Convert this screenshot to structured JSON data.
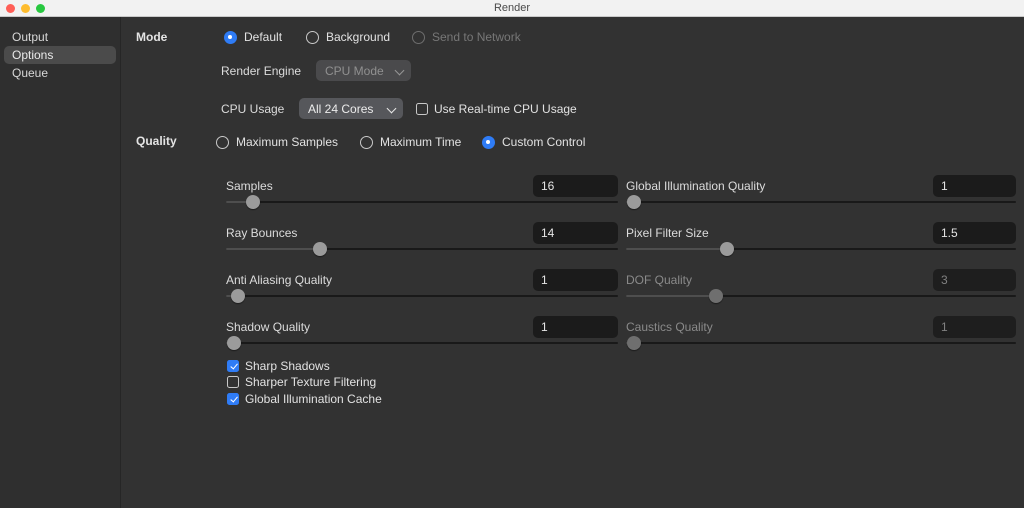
{
  "window": {
    "title": "Render",
    "traffic_lights": [
      "close-button",
      "minimize-button",
      "zoom-button"
    ]
  },
  "sidebar": {
    "items": [
      {
        "label": "Output",
        "selected": false
      },
      {
        "label": "Options",
        "selected": true
      },
      {
        "label": "Queue",
        "selected": false
      }
    ]
  },
  "mode": {
    "section_label": "Mode",
    "options": [
      {
        "label": "Default",
        "selected": true,
        "disabled": false
      },
      {
        "label": "Background",
        "selected": false,
        "disabled": false
      },
      {
        "label": "Send to Network",
        "selected": false,
        "disabled": true
      }
    ],
    "render_engine": {
      "label": "Render Engine",
      "value": "CPU Mode",
      "disabled": true,
      "options": [
        "CPU Mode"
      ]
    },
    "cpu_usage": {
      "label": "CPU Usage",
      "value": "All 24 Cores",
      "disabled": false,
      "options": [
        "All 24 Cores"
      ]
    },
    "realtime_cpu": {
      "label": "Use Real-time CPU Usage",
      "checked": false
    }
  },
  "quality": {
    "section_label": "Quality",
    "options": [
      {
        "label": "Maximum Samples",
        "selected": false
      },
      {
        "label": "Maximum Time",
        "selected": false
      },
      {
        "label": "Custom Control",
        "selected": true
      }
    ],
    "sliders_left": [
      {
        "label": "Samples",
        "value": "16",
        "fill_pct": 7,
        "disabled": false
      },
      {
        "label": "Ray Bounces",
        "value": "14",
        "fill_pct": 24,
        "disabled": false
      },
      {
        "label": "Anti Aliasing Quality",
        "value": "1",
        "fill_pct": 3,
        "disabled": false
      },
      {
        "label": "Shadow Quality",
        "value": "1",
        "fill_pct": 2,
        "disabled": false
      }
    ],
    "sliders_right": [
      {
        "label": "Global Illumination Quality",
        "value": "1",
        "fill_pct": 2,
        "disabled": false
      },
      {
        "label": "Pixel Filter Size",
        "value": "1.5",
        "fill_pct": 26,
        "disabled": false
      },
      {
        "label": "DOF Quality",
        "value": "3",
        "fill_pct": 23,
        "disabled": true
      },
      {
        "label": "Caustics Quality",
        "value": "1",
        "fill_pct": 2,
        "disabled": true
      }
    ],
    "checkboxes": [
      {
        "label": "Sharp Shadows",
        "checked": true
      },
      {
        "label": "Sharper Texture Filtering",
        "checked": false
      },
      {
        "label": "Global Illumination Cache",
        "checked": true
      }
    ]
  },
  "colors": {
    "accent_blue": "#2f7cf6",
    "window_bg": "#323232",
    "sidebar_bg": "#2f2f2f",
    "titlebar_bg": "#f2f2f2",
    "value_box_bg": "#1b1b1b",
    "select_bg": "#56575b"
  }
}
